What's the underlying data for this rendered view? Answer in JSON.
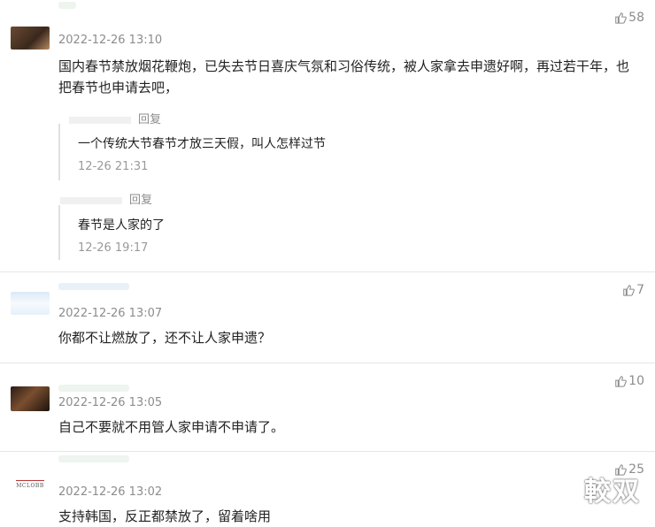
{
  "comments": [
    {
      "time": "2022-12-26 13:10",
      "text": "国内春节禁放烟花鞭炮，已失去节日喜庆气氛和习俗传统，被人家拿去申遗好啊，再过若干年，也把春节也申请去吧，",
      "likes": "58",
      "replies": [
        {
          "label": "回复",
          "text": "一个传统大节春节才放三天假，叫人怎样过节",
          "time": "12-26 21:31"
        },
        {
          "label": "回复",
          "text": "春节是人家的了",
          "time": "12-26 19:17"
        }
      ]
    },
    {
      "time": "2022-12-26 13:07",
      "text": "你都不让燃放了，还不让人家申遗？",
      "likes": "7"
    },
    {
      "time": "2022-12-26 13:05",
      "text": "自己不要就不用管人家申请不申请了。",
      "likes": "10"
    },
    {
      "time": "2022-12-26 13:02",
      "text": "支持韩国，反正都禁放了，留着啥用",
      "likes": "25"
    }
  ],
  "watermark": "較双",
  "avatar4_text": "MCLOBB"
}
